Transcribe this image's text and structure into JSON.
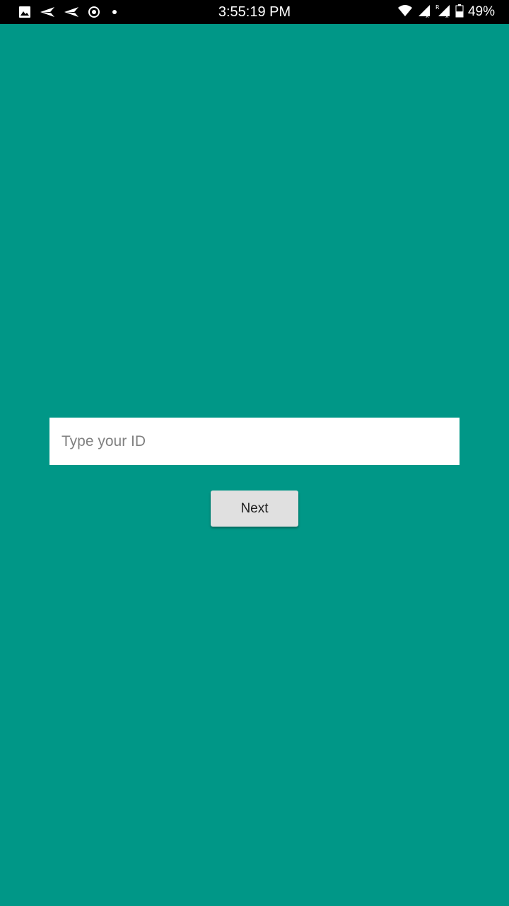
{
  "status_bar": {
    "time": "3:55:19 PM",
    "battery_percent": "49%",
    "battery_level": 0.49,
    "left_icons": [
      "image-icon",
      "send-icon",
      "send-icon",
      "record-icon",
      "dot-icon"
    ],
    "right_icons": [
      "wifi-icon",
      "signal-no-data-icon",
      "signal-roaming-icon",
      "battery-icon"
    ],
    "roaming_letter": "R"
  },
  "form": {
    "id_placeholder": "Type your ID",
    "id_value": "",
    "next_label": "Next"
  },
  "colors": {
    "background": "#009787",
    "status_bar": "#000000",
    "input_background": "#ffffff",
    "button_background": "#e0e0e0"
  }
}
